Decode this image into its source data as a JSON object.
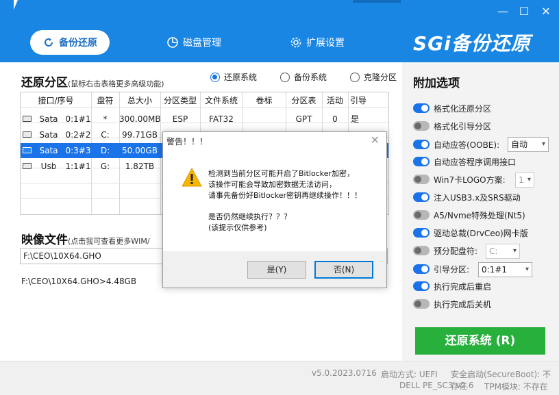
{
  "window": {
    "minimize": "—",
    "maximize": "☐",
    "close": "✕"
  },
  "tabs": [
    {
      "label": "备份还原",
      "icon": "refresh-icon"
    },
    {
      "label": "磁盘管理",
      "icon": "pie-chart-icon"
    },
    {
      "label": "扩展设置",
      "icon": "gear-icon"
    }
  ],
  "brand": "SGi备份还原",
  "restore": {
    "title": "还原分区",
    "hint": "(鼠标右击表格更多高级功能)",
    "modes": [
      {
        "label": "还原系统",
        "checked": true
      },
      {
        "label": "备份系统",
        "checked": false
      },
      {
        "label": "克隆分区",
        "checked": false
      }
    ]
  },
  "table": {
    "headers": [
      "接口/序号",
      "盘符",
      "总大小",
      "分区类型",
      "文件系统",
      "卷标",
      "分区表",
      "活动",
      "引导"
    ],
    "rows": [
      {
        "iface": "Sata",
        "num": "0:1#1",
        "drive": "*",
        "size": "300.00MB",
        "type": "ESP",
        "fs": "FAT32",
        "label": "",
        "pt": "GPT",
        "active": "0",
        "boot": "是",
        "selected": false
      },
      {
        "iface": "Sata",
        "num": "0:2#2",
        "drive": "C:",
        "size": "99.71GB",
        "type": "",
        "fs": "",
        "label": "",
        "pt": "",
        "active": "",
        "boot": "",
        "selected": false
      },
      {
        "iface": "Sata",
        "num": "0:3#3",
        "drive": "D:",
        "size": "50.00GB",
        "type": "",
        "fs": "",
        "label": "",
        "pt": "",
        "active": "",
        "boot": "",
        "selected": true
      },
      {
        "iface": "Usb",
        "num": "1:1#1",
        "drive": "G:",
        "size": "1.82TB",
        "type": "",
        "fs": "",
        "label": "",
        "pt": "",
        "active": "",
        "boot": "",
        "selected": false
      }
    ]
  },
  "image": {
    "title": "映像文件",
    "hint": "(点击我可查看更多WIM/",
    "path": "F:\\CEO\\10X64.GHO",
    "info": "F:\\CEO\\10X64.GHO>4.48GB"
  },
  "options": {
    "title": "附加选项",
    "items": [
      {
        "label": "格式化还原分区",
        "on": true
      },
      {
        "label": "格式化引导分区",
        "on": false
      },
      {
        "label": "自动应答(OOBE):",
        "on": true,
        "combo": "自动"
      },
      {
        "label": "自动应答程序调用接口",
        "on": true
      },
      {
        "label": "Win7卡LOGO方案:",
        "on": false,
        "combo": "1",
        "combo_disabled": true
      },
      {
        "label": "注入USB3.x及SRS驱动",
        "on": true
      },
      {
        "label": "A5/Nvme特殊处理(Nt5)",
        "on": false
      },
      {
        "label": "驱动总裁(DrvCeo)网卡版",
        "on": true
      },
      {
        "label": "预分配盘符:",
        "on": false,
        "combo": "C:",
        "combo_disabled": true
      },
      {
        "label": "引导分区:",
        "on": true,
        "combo": "0:1#1"
      },
      {
        "label": "执行完成后重启",
        "on": true
      },
      {
        "label": "执行完成后关机",
        "on": false
      }
    ],
    "action": "还原系统 (R)"
  },
  "footer": {
    "version": "v5.0.2023.0716",
    "boot_mode": "启动方式: UEFI",
    "secure_boot": "安全启动(SecureBoot): 不存在",
    "machine": "DELL PE_SC3 v2.6",
    "tpm": "TPM模块: 不存在"
  },
  "dialog": {
    "title": "警告！！！",
    "lines": [
      "检测到当前分区可能开启了Bitlocker加密，",
      "该操作可能会导致加密数据无法访问，",
      "请事先备份好Bitlocker密钥再继续操作！！！",
      "",
      "是否仍然继续执行？？？",
      "(该提示仅供参考)"
    ],
    "yes": "是(Y)",
    "no": "否(N)"
  },
  "colors": {
    "accent": "#1a86e3",
    "selected_row": "#1a73e8",
    "action_button": "#27b03c",
    "warning": "#f7b500"
  }
}
